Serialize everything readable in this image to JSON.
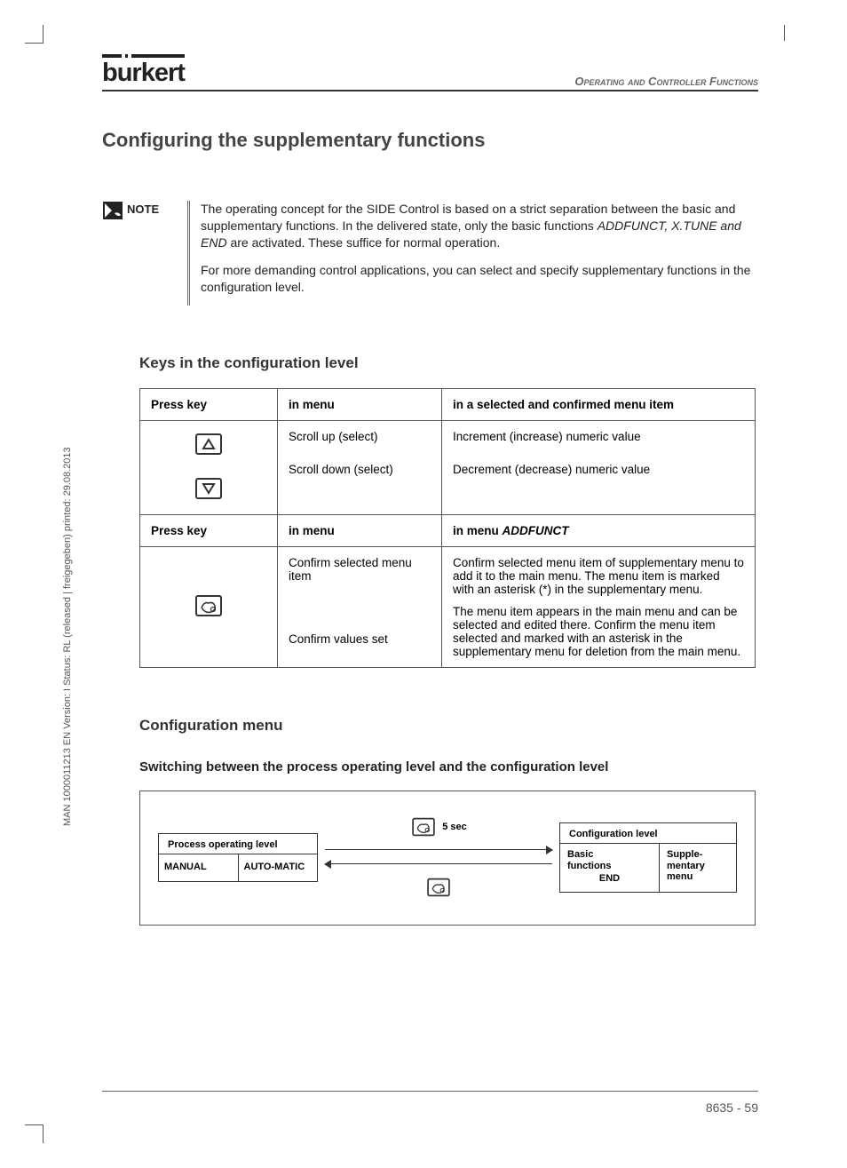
{
  "meta": {
    "side_text": "MAN 1000011213 EN Version: I Status: RL (released | freigegeben) printed: 29.08.2013"
  },
  "header": {
    "brand": "burkert",
    "section": "Operating and Controller Functions"
  },
  "title": "Configuring the supplementary functions",
  "note": {
    "label": "NOTE",
    "p1a": "The operating concept for the SIDE Control is based on a strict separation between the basic and supplementary functions. In the delivered state, only the basic functions",
    "p1b": "ADDFUNCT, X.TUNE and END",
    "p1c": "are activated. These suffice for normal operation.",
    "p2": "For more demanding control applications, you can select and specify supplementary functions in the configuration level."
  },
  "keys": {
    "heading": "Keys in the configuration level",
    "col_press": "Press key",
    "col_menu": "in menu",
    "col_selected": "in a selected and confirmed menu item",
    "col_addfunct_pre": "in menu",
    "col_addfunct_em": "ADDFUNCT",
    "r1": {
      "menu_up": "Scroll up (select)",
      "menu_down": "Scroll down (select)",
      "sel_up": "Increment (increase) numeric value",
      "sel_down": "Decrement (decrease) numeric value"
    },
    "r2": {
      "menu_confirm": "Confirm selected menu item",
      "menu_values": "Confirm values set",
      "add_confirm": "Confirm selected menu item of supplementary menu to add it to the main menu. The menu item is marked with an asterisk (*) in the supplementary menu.",
      "add_values": "The menu item appears in the main menu and can be selected and edited there. Confirm the menu item selected and marked with an asterisk in the supplementary menu for deletion from the main menu."
    }
  },
  "config": {
    "heading": "Configuration menu",
    "subheading": "Switching between the process operating level and the configuration level",
    "diagram": {
      "process_title": "Process operating level",
      "manual": "MANUAL",
      "automatic": "AUTO-MATIC",
      "duration": "5 sec",
      "config_title": "Configuration level",
      "basic_line1": "Basic",
      "basic_line2": "functions",
      "end": "END",
      "supp_line1": "Supple-",
      "supp_line2": "mentary",
      "supp_line3": "menu"
    }
  },
  "footer": "8635  -  59"
}
